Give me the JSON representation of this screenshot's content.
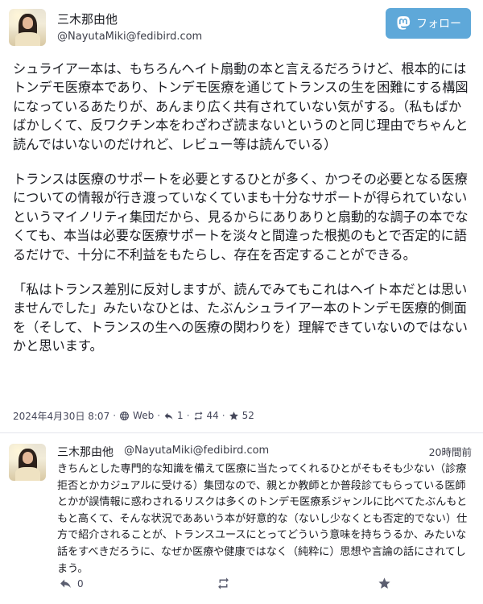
{
  "main_post": {
    "display_name": "三木那由他",
    "acct": "@NayutaMiki@fedibird.com",
    "follow_label": "フォロー",
    "paragraphs": [
      "シュライアー本は、もちろんヘイト扇動の本と言えるだろうけど、根本的にはトンデモ医療本であり、トンデモ医療を通じてトランスの生を困難にする構図になっているあたりが、あんまり広く共有されていない気がする。（私もばかばかしくて、反ワクチン本をわざわざ読まないというのと同じ理由でちゃんと読んではいないのだけれど、レビュー等は読んでいる）",
      "トランスは医療のサポートを必要とするひとが多く、かつその必要となる医療についての情報が行き渡っていなくていまも十分なサポートが得られていないというマイノリティ集団だから、見るからにありありと扇動的な調子の本でなくても、本当は必要な医療サポートを淡々と間違った根拠のもとで否定的に語るだけで、十分に不利益をもたらし、存在を否定することができる。",
      "「私はトランス差別に反対しますが、読んでみてもこれはヘイト本だとは思いませんでした」みたいなひとは、たぶんシュライアー本のトンデモ医療的側面を（そして、トランスの生への医療の関わりを）理解できていないのではないかと思います。"
    ],
    "timestamp": "2024年4月30日 8:07",
    "visibility": "Web",
    "dot": "·",
    "replies": "1",
    "boosts": "44",
    "favourites": "52"
  },
  "reply": {
    "display_name": "三木那由他",
    "acct": "@NayutaMiki@fedibird.com",
    "relative_time": "20時間前",
    "content": "きちんとした専門的な知識を備えて医療に当たってくれるひとがそもそも少ない（診療拒否とかカジュアルに受ける）集団なので、親とか教師とか普段診てもらっている医師とかが誤情報に惑わされるリスクは多くのトンデモ医療系ジャンルに比べてたぶんもともと高くて、そんな状況でああいう本が好意的な（ないし少なくとも否定的でない）仕方で紹介されることが、トランスユースにとってどういう意味を持ちうるか、みたいな話をすべきだろうに、なぜか医療や健康ではなく（純粋に）思想や言論の話にされてしまう。",
    "replies": "0"
  },
  "icons": {
    "follow": "mastodon-icon",
    "visibility": "globe-icon",
    "reply": "reply-icon",
    "boost": "boost-icon",
    "favourite": "star-icon"
  },
  "colors": {
    "follow_button": "#5ea8d9",
    "text": "#1b1c22",
    "muted": "#45475a"
  }
}
